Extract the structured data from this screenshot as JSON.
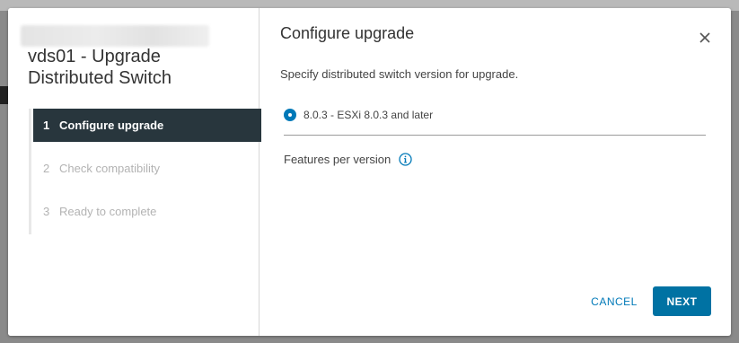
{
  "wizard": {
    "title": "vds01 - Upgrade Distributed Switch",
    "steps": [
      {
        "number": "1",
        "label": "Configure upgrade",
        "state": "active"
      },
      {
        "number": "2",
        "label": "Check compatibility",
        "state": "disabled"
      },
      {
        "number": "3",
        "label": "Ready to complete",
        "state": "disabled"
      }
    ]
  },
  "main": {
    "title": "Configure upgrade",
    "subtitle": "Specify distributed switch version for upgrade.",
    "version_option": "8.0.3 - ESXi 8.0.3 and later",
    "version_selected": true,
    "features_label": "Features per version",
    "features_icon": "info-icon"
  },
  "footer": {
    "cancel_label": "CANCEL",
    "next_label": "NEXT"
  },
  "colors": {
    "accent": "#0079b8",
    "primary_button": "#0072a3",
    "active_step_bg": "#28363d"
  },
  "icons": {
    "close": "close-icon",
    "info": "info-icon"
  }
}
